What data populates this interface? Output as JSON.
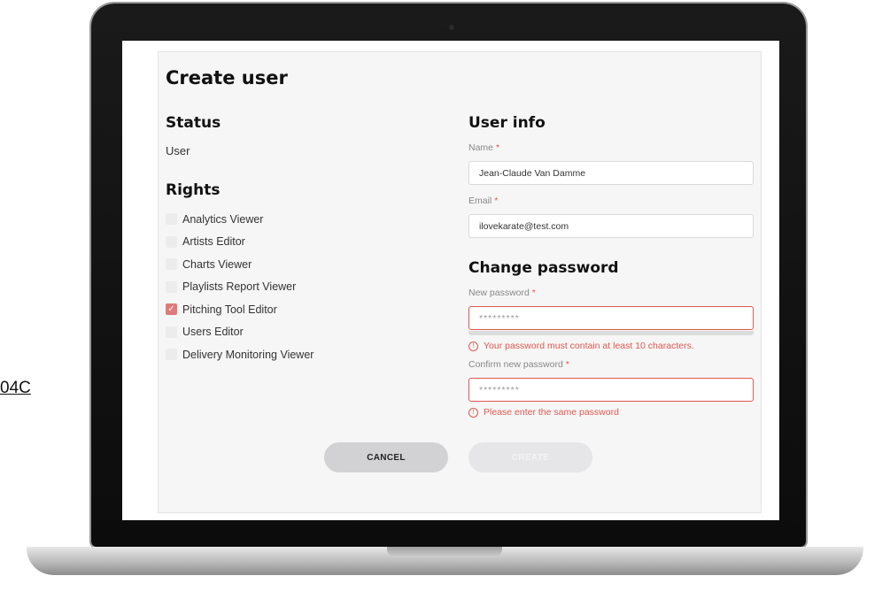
{
  "stray_text": "04C",
  "form": {
    "title": "Create user",
    "status": {
      "heading": "Status",
      "value": "User"
    },
    "rights": {
      "heading": "Rights",
      "items": [
        {
          "label": "Analytics Viewer",
          "checked": false
        },
        {
          "label": "Artists Editor",
          "checked": false
        },
        {
          "label": "Charts Viewer",
          "checked": false
        },
        {
          "label": "Playlists Report Viewer",
          "checked": false
        },
        {
          "label": "Pitching Tool Editor",
          "checked": true
        },
        {
          "label": "Users Editor",
          "checked": false
        },
        {
          "label": "Delivery Monitoring Viewer",
          "checked": false
        }
      ]
    },
    "user_info": {
      "heading": "User info",
      "name_label": "Name",
      "name_value": "Jean-Claude Van Damme",
      "email_label": "Email",
      "email_value": "ilovekarate@test.com"
    },
    "password": {
      "heading": "Change password",
      "new_label": "New password",
      "new_value": "*********",
      "new_error": "Your password must contain at least 10 characters.",
      "confirm_label": "Confirm new password",
      "confirm_value": "*********",
      "confirm_error": "Please enter the same password"
    },
    "required_mark": "*",
    "error_icon": "!",
    "check_mark": "✓",
    "cancel_label": "CANCEL",
    "create_label": "CREATE"
  },
  "colors": {
    "accent_error": "#e0584f",
    "checked": "#e07a7a"
  }
}
